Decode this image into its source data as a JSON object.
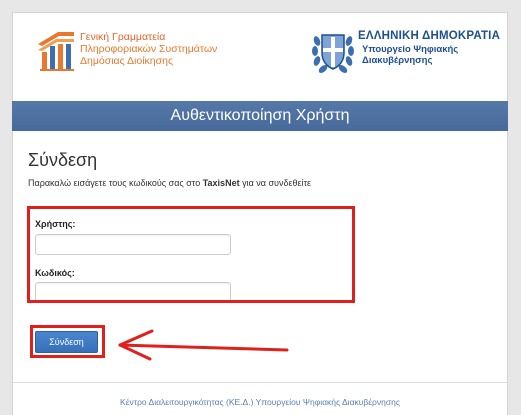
{
  "header": {
    "left_logo": {
      "icon": "ggps-logo-icon",
      "line1": "Γενική Γραμματεία",
      "line2": "Πληροφοριακών Συστημάτων",
      "line3": "Δημόσιας Διοίκησης"
    },
    "right_logo": {
      "icon": "greek-emblem-icon",
      "line1": "ΕΛΛΗΝΙΚΗ ΔΗΜΟΚΡΑΤΙΑ",
      "line2": "Υπουργείο Ψηφιακής",
      "line3": "Διακυβέρνησης"
    }
  },
  "banner": {
    "title": "Αυθεντικοποίηση Χρήστη"
  },
  "login": {
    "heading": "Σύνδεση",
    "instructions_before": "Παρακαλώ εισάγετε τους κωδικούς σας στο ",
    "instructions_brand": "TaxisNet",
    "instructions_after": " για να συνδεθείτε",
    "username_label": "Χρήστης:",
    "password_label": "Κωδικός:",
    "submit_label": "Σύνδεση"
  },
  "footer": {
    "link": "Κέντρο Διαλειτουργικότητας (ΚΕ.Δ.) Υπουργείου Ψηφιακής Διακυβέρνησης"
  },
  "colors": {
    "banner": "#4d6f9f",
    "submit_button": "#3a76c0",
    "ggps_orange": "#e8782e",
    "emblem_blue": "#1e4f92",
    "annotation_red": "#e0201c",
    "footer_link": "#5a7fb6"
  }
}
